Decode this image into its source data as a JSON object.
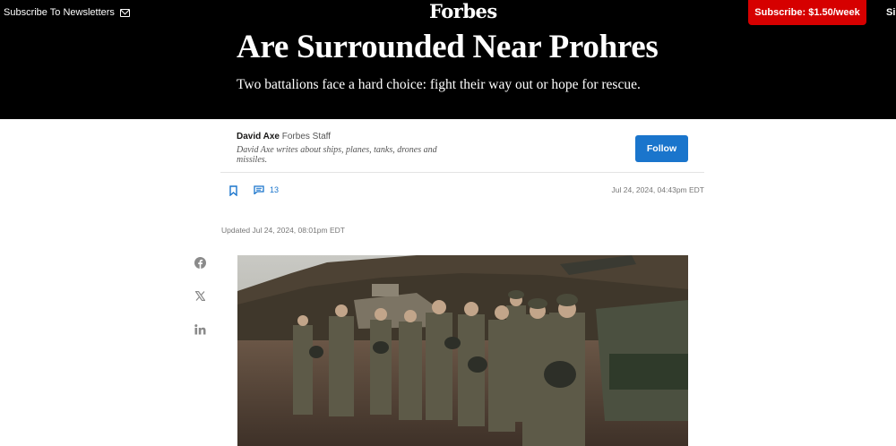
{
  "nav": {
    "subscribe_newsletters": "Subscribe To Newsletters",
    "logo": "Forbes",
    "subscribe_button": "Subscribe: $1.50/week",
    "signin_partial": "Si"
  },
  "hero": {
    "headline": "Are Surrounded Near Prohres",
    "dek": "Two battalions face a hard choice: fight their way out or hope for rescue."
  },
  "byline": {
    "author": "David Axe",
    "role": "Forbes Staff",
    "description": "David Axe writes about ships, planes, tanks, drones and missiles.",
    "follow_label": "Follow"
  },
  "meta": {
    "comment_count": "13",
    "published": "Jul 24, 2024, 04:43pm EDT",
    "updated": "Updated Jul 24, 2024, 08:01pm EDT"
  },
  "share": [
    "facebook-icon",
    "x-icon",
    "linkedin-icon"
  ],
  "colors": {
    "accent_blue": "#1a75cc",
    "subscribe_red": "#d60000",
    "header_bg": "#000000"
  }
}
